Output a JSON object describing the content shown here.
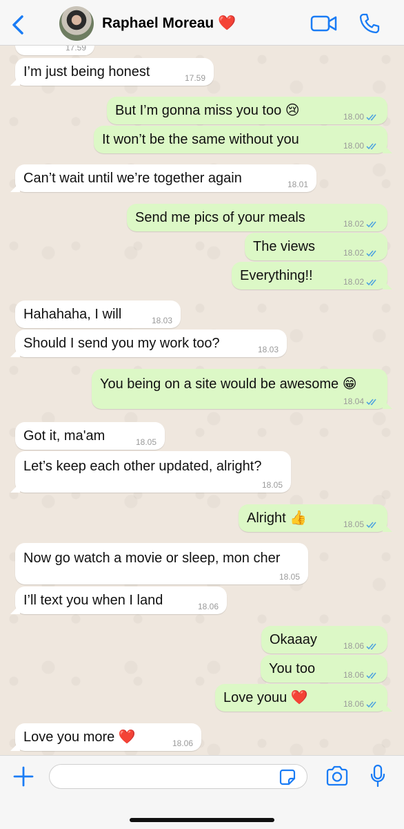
{
  "header": {
    "contact_name": "Raphael Moreau ❤️",
    "icons": {
      "back": "chevron-left-icon",
      "video": "video-camera-icon",
      "call": "phone-icon"
    },
    "accent_color": "#1a7cf5"
  },
  "messages": [
    {
      "id": "m0",
      "dir": "in",
      "text": "",
      "time": "17.59"
    },
    {
      "id": "m1",
      "dir": "in",
      "text": "I’m just being honest",
      "time": "17.59"
    },
    {
      "id": "m2",
      "dir": "out",
      "text": "But I’m gonna miss you too 😢",
      "time": "18.00",
      "status": "read"
    },
    {
      "id": "m3",
      "dir": "out",
      "text": "It won’t be the same without you",
      "time": "18.00",
      "status": "read"
    },
    {
      "id": "m4",
      "dir": "in",
      "text": "Can’t wait until we’re together again",
      "time": "18.01"
    },
    {
      "id": "m5",
      "dir": "out",
      "text": "Send me pics of your meals",
      "time": "18.02",
      "status": "read"
    },
    {
      "id": "m6",
      "dir": "out",
      "text": "The views",
      "time": "18.02",
      "status": "read"
    },
    {
      "id": "m7",
      "dir": "out",
      "text": "Everything!!",
      "time": "18.02",
      "status": "read"
    },
    {
      "id": "m8",
      "dir": "in",
      "text": "Hahahaha, I will",
      "time": "18.03"
    },
    {
      "id": "m9",
      "dir": "in",
      "text": "Should I send you my work too?",
      "time": "18.03"
    },
    {
      "id": "m10",
      "dir": "out",
      "text": "You being on a site would be awesome 😁",
      "time": "18.04",
      "status": "read"
    },
    {
      "id": "m11",
      "dir": "in",
      "text": "Got it, ma'am",
      "time": "18.05"
    },
    {
      "id": "m12",
      "dir": "in",
      "text": "Let’s keep each other updated, alright?",
      "time": "18.05"
    },
    {
      "id": "m13",
      "dir": "out",
      "text": "Alright 👍",
      "time": "18.05",
      "status": "read"
    },
    {
      "id": "m14",
      "dir": "in",
      "text": "Now go watch a movie or sleep, mon cher",
      "time": "18.05"
    },
    {
      "id": "m15",
      "dir": "in",
      "text": "I’ll text you when I land",
      "time": "18.06"
    },
    {
      "id": "m16",
      "dir": "out",
      "text": "Okaaay",
      "time": "18.06",
      "status": "read"
    },
    {
      "id": "m17",
      "dir": "out",
      "text": "You too",
      "time": "18.06",
      "status": "read"
    },
    {
      "id": "m18",
      "dir": "out",
      "text": "Love youu ❤️",
      "time": "18.06",
      "status": "read"
    },
    {
      "id": "m19",
      "dir": "in",
      "text": "Love you more ❤️",
      "time": "18.06"
    }
  ],
  "input_bar": {
    "placeholder": "",
    "icons": {
      "plus": "plus-icon",
      "sticker": "sticker-icon",
      "camera": "camera-icon",
      "mic": "microphone-icon"
    }
  },
  "colors": {
    "incoming": "#ffffff",
    "outgoing": "#dcf8c6",
    "read_ticks": "#4fa3e0",
    "chat_bg": "#efe7de"
  }
}
